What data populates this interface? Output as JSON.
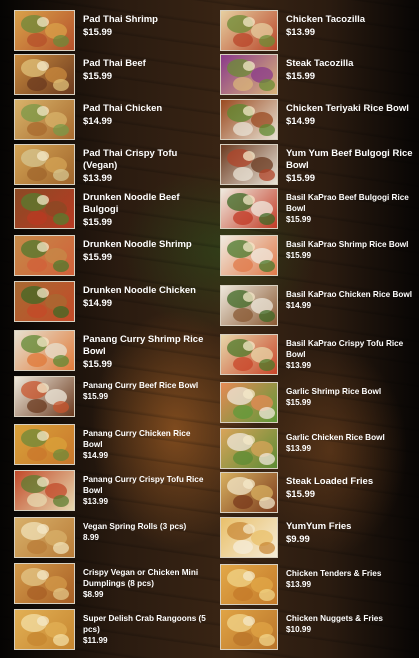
{
  "menu": {
    "left": [
      {
        "name": "Pad Thai Shrimp",
        "price": "$15.99",
        "colors": [
          "#d9a24a",
          "#b5502b",
          "#6c8a3a"
        ]
      },
      {
        "name": "Pad Thai Beef",
        "price": "$15.99",
        "colors": [
          "#c98a3e",
          "#6b3a1f",
          "#e0c27a"
        ]
      },
      {
        "name": "Pad Thai Chicken",
        "price": "$14.99",
        "colors": [
          "#d8b36a",
          "#a86a2e",
          "#7a9a48"
        ]
      },
      {
        "name": "Pad Thai Crispy Tofu (Vegan)",
        "price": "$13.99",
        "colors": [
          "#d4a455",
          "#a0652c",
          "#d6c690"
        ]
      },
      {
        "name": "Drunken Noodle Beef Bulgogi",
        "price": "$15.99",
        "colors": [
          "#8a4a24",
          "#b93a23",
          "#557d2f"
        ]
      },
      {
        "name": "Drunken Noodle Shrimp",
        "price": "$15.99",
        "colors": [
          "#c58a48",
          "#d2603a",
          "#4f7a2e"
        ]
      },
      {
        "name": "Drunken Noodle Chicken",
        "price": "$14.99",
        "colors": [
          "#a86a32",
          "#c44a28",
          "#3f6a26"
        ]
      },
      {
        "name": "Panang Curry Shrimp Rice Bowl",
        "price": "$15.99",
        "colors": [
          "#e7e0cf",
          "#e07a3a",
          "#5f8a34"
        ]
      },
      {
        "name": "Panang Curry Beef Rice Bowl",
        "price": "$15.99",
        "small": true,
        "colors": [
          "#efe9dc",
          "#6b3a1f",
          "#c8542c"
        ]
      },
      {
        "name": "Panang Curry Chicken Rice Bowl",
        "price": "$14.99",
        "small": true,
        "colors": [
          "#d9a23a",
          "#c9772c",
          "#6d8a3a"
        ]
      },
      {
        "name": "Panang Curry Crispy Tofu Rice Bowl",
        "price": "$13.99",
        "small": true,
        "colors": [
          "#c24a2a",
          "#e7d9b0",
          "#5c7d30"
        ]
      },
      {
        "name": "Vegan Spring Rolls (3 pcs)",
        "price": "8.99",
        "small": true,
        "colors": [
          "#d8b06a",
          "#b97c38",
          "#f0e2b8"
        ]
      },
      {
        "name": "Crispy Vegan or Chicken Mini Dumplings (8 pcs)",
        "price": "$8.99",
        "small": true,
        "colors": [
          "#d39a4a",
          "#a85f25",
          "#e3c587"
        ]
      },
      {
        "name": "Super Delish Crab Rangoons (5 pcs)",
        "price": "$11.99",
        "small": true,
        "colors": [
          "#e2b055",
          "#c68630",
          "#f3dfa5"
        ]
      }
    ],
    "right": [
      {
        "name": "Chicken Tacozilla",
        "price": "$13.99",
        "colors": [
          "#e6cfa0",
          "#b9462a",
          "#6c8c35"
        ]
      },
      {
        "name": "Steak Tacozilla",
        "price": "$15.99",
        "colors": [
          "#8a3a8a",
          "#d9b47a",
          "#6b8d34"
        ]
      },
      {
        "name": "Chicken Teriyaki Rice Bowl",
        "price": "$14.99",
        "colors": [
          "#9a4a20",
          "#e8e2d4",
          "#5e8a30"
        ]
      },
      {
        "name": "Yum Yum Beef Bulgogi Rice Bowl",
        "price": "$15.99",
        "colors": [
          "#6b3a20",
          "#e9e3d6",
          "#b0442a"
        ]
      },
      {
        "name": "Basil KaPrao Beef Bulgogi Rice Bowl",
        "price": "$15.99",
        "small": true,
        "colors": [
          "#f0ebe0",
          "#c23a25",
          "#3e6a25"
        ]
      },
      {
        "name": "Basil KaPrao Shrimp Rice Bowl",
        "price": "$15.99",
        "small": true,
        "colors": [
          "#f0ebe0",
          "#e07a4a",
          "#4a7a2c"
        ]
      },
      {
        "name": "Basil KaPrao Chicken Rice Bowl",
        "price": "$14.99",
        "small": true,
        "colors": [
          "#eee8dc",
          "#8a5a34",
          "#3f6a26"
        ]
      },
      {
        "name": "Basil KaPrao Crispy Tofu Rice Bowl",
        "price": "$13.99",
        "small": true,
        "colors": [
          "#e8d7aa",
          "#c8452a",
          "#4c7a2a"
        ]
      },
      {
        "name": "Garlic Shrimp Rice Bowl",
        "price": "$15.99",
        "small": true,
        "colors": [
          "#e58a55",
          "#5f9a3a",
          "#f0e8dc"
        ]
      },
      {
        "name": "Garlic Chicken  Rice Bowl",
        "price": "$13.99",
        "small": true,
        "colors": [
          "#d9a45a",
          "#5c8c34",
          "#f0e8dc"
        ]
      },
      {
        "name": "Steak Loaded Fries",
        "price": "$15.99",
        "colors": [
          "#d8b060",
          "#7a3a1c",
          "#f2e6c8"
        ]
      },
      {
        "name": "YumYum Fries",
        "price": "$9.99",
        "colors": [
          "#e9c06a",
          "#f5ecd8",
          "#c98a3a"
        ]
      },
      {
        "name": "Chicken Tenders & Fries",
        "price": "$13.99",
        "small": true,
        "colors": [
          "#e2a848",
          "#c47a2a",
          "#f0d488"
        ]
      },
      {
        "name": "Chicken Nuggets & Fries",
        "price": "$10.99",
        "small": true,
        "colors": [
          "#e0a445",
          "#b9742a",
          "#f2d68c"
        ]
      }
    ]
  }
}
